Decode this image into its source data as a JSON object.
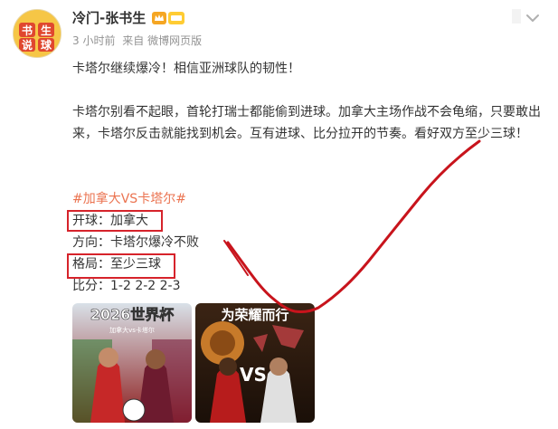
{
  "post": {
    "author": "冷门-张书生",
    "meta": {
      "time": "3 小时前",
      "source": "来自 微博网页版"
    },
    "paragraph1": "卡塔尔继续爆冷！相信亚洲球队的韧性！",
    "paragraph2": "卡塔尔别看不起眼，首轮打瑞士都能偷到进球。加拿大主场作战不会龟缩，只要敢出来，卡塔尔反击就能找到机会。互有进球、比分拉开的节奏。看好双方至少三球！",
    "hashtag": "#加拿大VS卡塔尔#",
    "lines": [
      "开球：加拿大",
      "方向：卡塔尔爆冷不败",
      "格局：至少三球",
      "比分：1-2 2-2 2-3"
    ]
  },
  "avatar": {
    "logo_text": "书生说球"
  },
  "images": [
    {
      "title": "2026世界杯",
      "subtitle": "加拿大vs卡塔尔",
      "alt": "plauers-match-poster"
    },
    {
      "title": "为荣耀而行",
      "alt": "lion-and-eagle-poster"
    }
  ],
  "colors": {
    "hashtag": "#eb7350",
    "highlight_box": "#d6232b",
    "scribble": "#c8141c"
  },
  "icons": {
    "collapse": "chevron-down-icon",
    "vip": "crown-badge-icon"
  }
}
